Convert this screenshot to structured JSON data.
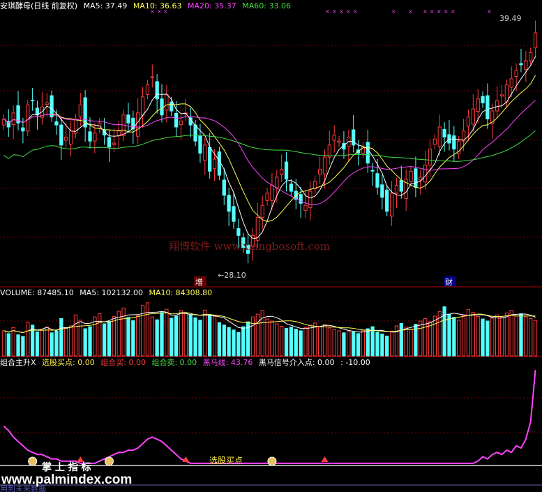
{
  "price_header": {
    "stock": "安琪酵母(日线 前复权)",
    "ma5": "MA5: 37.49",
    "ma10": "MA10: 36.63",
    "ma20": "MA20: 35.37",
    "ma60": "MA60: 33.06"
  },
  "price_labels": {
    "high": "39.49",
    "low": "←28.10",
    "zeng": "增",
    "cai": "财"
  },
  "volume_header": {
    "volume": "VOLUME: 87485.10",
    "ma5": "MA5: 102132.00",
    "ma10": "MA10: 84308.80"
  },
  "indicator_header": {
    "name": "组合主升X",
    "select": "选股买点: 0.00",
    "buy": "组合买: 0.00",
    "sell": "组合卖: 0.00",
    "dark_horse": "黑马线: 43.76",
    "entry": "黑马信号介入点: 0.00",
    "extra": ": -10.00"
  },
  "annotations": {
    "watermark": "翔博软件 www.xiangbosoft.com",
    "buy_point": "选股买点",
    "brand": "掌 上 指 标",
    "site": "www.palmindex.com",
    "bottom_left": "用到未来数据"
  },
  "colors": {
    "background": "#000000",
    "up": "#ff3b3b",
    "down": "#54ffff",
    "ma5": "#ffffff",
    "ma10": "#ffff55",
    "ma20": "#ff44ff",
    "ma60": "#44dd44",
    "dark_horse": "#ff44ff",
    "divider": "#aa0000"
  },
  "chart_data": [
    {
      "type": "candlestick",
      "title": "安琪酵母(日线 前复权)",
      "ylim": [
        27.5,
        40.5
      ],
      "high_label": 39.49,
      "low_label": 28.1,
      "series_names": [
        "MA5",
        "MA10",
        "MA20",
        "MA60"
      ],
      "close": [
        35.2,
        34.8,
        35.5,
        35.0,
        34.6,
        35.9,
        36.1,
        35.4,
        35.8,
        36.0,
        35.3,
        34.9,
        33.9,
        34.3,
        34.6,
        35.2,
        35.9,
        34.8,
        34.1,
        34.5,
        35.0,
        34.4,
        33.8,
        34.0,
        34.6,
        35.4,
        35.0,
        34.7,
        35.5,
        36.3,
        36.9,
        37.3,
        36.2,
        35.4,
        36.4,
        35.6,
        34.8,
        35.1,
        35.5,
        34.9,
        34.1,
        33.5,
        33.9,
        32.6,
        33.2,
        32.4,
        31.4,
        30.6,
        30.1,
        29.4,
        28.8,
        28.5,
        29.4,
        30.3,
        30.9,
        31.5,
        31.9,
        32.3,
        32.7,
        32.2,
        31.6,
        31.2,
        31.0,
        30.9,
        31.6,
        32.1,
        32.7,
        33.3,
        33.9,
        34.4,
        34.1,
        33.7,
        34.3,
        33.9,
        33.5,
        33.8,
        33.0,
        32.6,
        31.8,
        31.3,
        30.6,
        31.5,
        31.9,
        31.6,
        32.2,
        32.6,
        31.8,
        32.3,
        32.9,
        33.7,
        34.2,
        34.8,
        34.3,
        34.0,
        33.7,
        34.1,
        34.6,
        35.3,
        35.7,
        36.2,
        36.0,
        35.2,
        35.6,
        36.1,
        36.4,
        36.9,
        37.2,
        37.6,
        37.9,
        38.1,
        38.5,
        39.49
      ],
      "volume": [
        62000,
        55000,
        70000,
        52000,
        48000,
        83000,
        76000,
        59000,
        64000,
        71000,
        57000,
        61000,
        92000,
        68000,
        74000,
        101000,
        88000,
        67000,
        72000,
        96000,
        104000,
        79000,
        85000,
        97000,
        110000,
        118000,
        95000,
        87000,
        99000,
        124000,
        131000,
        96000,
        89000,
        107000,
        115000,
        93000,
        98000,
        112000,
        106000,
        101000,
        94000,
        88000,
        113000,
        102000,
        97000,
        82000,
        76000,
        70000,
        64000,
        58000,
        72000,
        84000,
        96000,
        103000,
        112000,
        91000,
        86000,
        79000,
        73000,
        68000,
        71000,
        66000,
        62000,
        70000,
        76000,
        81000,
        73000,
        77000,
        69000,
        65000,
        62000,
        57000,
        61000,
        59000,
        55000,
        63000,
        67000,
        72000,
        58000,
        54000,
        49000,
        61000,
        74000,
        80000,
        71000,
        66000,
        78000,
        86000,
        92000,
        84000,
        98000,
        109000,
        121000,
        103000,
        95000,
        88000,
        99000,
        114000,
        107000,
        97000,
        91000,
        86000,
        93000,
        101000,
        95000,
        106000,
        112000,
        98000,
        104000,
        96000,
        92000,
        87485
      ],
      "volume_ma5": 102132,
      "volume_ma10": 84308.8
    },
    {
      "type": "line",
      "title": "组合主升X",
      "series": [
        {
          "name": "黑马线",
          "values": [
            18,
            16,
            13,
            11,
            9,
            7,
            6,
            5,
            5,
            4,
            3,
            3,
            2,
            2,
            2,
            2,
            1,
            1,
            1,
            1,
            2,
            3,
            4,
            5,
            6,
            6,
            7,
            7,
            8,
            10,
            12,
            13,
            12,
            11,
            9,
            7,
            5,
            3,
            2,
            1,
            1,
            1,
            1,
            1,
            1,
            1,
            1,
            1,
            1,
            1,
            1,
            1,
            1,
            1,
            1,
            1,
            1,
            1,
            1,
            1,
            1,
            1,
            1,
            1,
            1,
            1,
            1,
            1,
            1,
            1,
            1,
            1,
            1,
            1,
            1,
            1,
            1,
            1,
            1,
            1,
            1,
            1,
            1,
            1,
            1,
            1,
            1,
            1,
            1,
            1,
            1,
            1,
            1,
            1,
            1,
            1,
            1,
            1,
            1,
            2,
            4,
            3,
            5,
            6,
            5,
            7,
            6,
            9,
            8,
            12,
            20,
            43.76
          ]
        }
      ],
      "markers": [
        {
          "type": "money",
          "index": 6
        },
        {
          "type": "buy",
          "index": 16
        },
        {
          "type": "money",
          "index": 22
        },
        {
          "type": "buy",
          "index": 38
        },
        {
          "type": "money",
          "index": 56
        },
        {
          "type": "buy",
          "index": 67
        }
      ]
    }
  ]
}
